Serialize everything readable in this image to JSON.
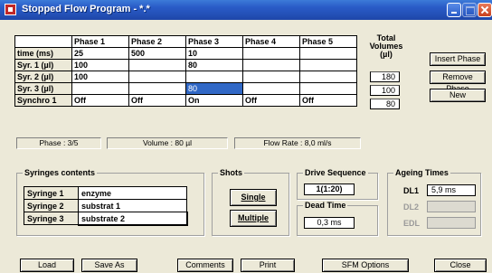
{
  "window": {
    "title": "Stopped Flow Program - *.*"
  },
  "grid": {
    "headers": [
      "",
      "Phase 1",
      "Phase 2",
      "Phase 3",
      "Phase 4",
      "Phase 5"
    ],
    "rows": [
      {
        "label": "time (ms)",
        "cells": [
          "25",
          "500",
          "10",
          "",
          ""
        ]
      },
      {
        "label": "Syr. 1 (µl)",
        "cells": [
          "100",
          "",
          "80",
          "",
          ""
        ]
      },
      {
        "label": "Syr. 2 (µl)",
        "cells": [
          "100",
          "",
          "",
          "",
          ""
        ]
      },
      {
        "label": "Syr. 3 (µl)",
        "cells": [
          "",
          "",
          "80",
          "",
          ""
        ]
      },
      {
        "label": "Synchro 1",
        "cells": [
          "Off",
          "Off",
          "On",
          "Off",
          "Off"
        ]
      }
    ]
  },
  "total_volumes": {
    "label_line1": "Total",
    "label_line2": "Volumes",
    "label_line3": "(µl)",
    "values": [
      "180",
      "100",
      "80"
    ]
  },
  "side_buttons": {
    "insert": "Insert Phase",
    "remove": "Remove Phase",
    "new": "New"
  },
  "status": {
    "phase": "Phase : 3/5",
    "volume": "Volume : 80 µl",
    "flow_rate": "Flow Rate : 8,0 ml/s"
  },
  "syringes": {
    "title": "Syringes contents",
    "items": [
      {
        "name": "Syringe  1",
        "value": "enzyme"
      },
      {
        "name": "Syringe  2",
        "value": "substrat 1"
      },
      {
        "name": "Syringe  3",
        "value": "substrate 2"
      }
    ]
  },
  "shots": {
    "title": "Shots",
    "single": "Single",
    "multiple": "Multiple"
  },
  "drive": {
    "title": "Drive Sequence",
    "value": "1(1:20)"
  },
  "dead_time": {
    "title": "Dead Time",
    "value": "0,3 ms"
  },
  "ageing": {
    "title": "Ageing Times",
    "dl1_label": "DL1",
    "dl1_value": "5,9 ms",
    "dl2_label": "DL2",
    "edl_label": "EDL"
  },
  "bottom_buttons": {
    "load": "Load",
    "save_as": "Save As",
    "comments": "Comments",
    "print": "Print",
    "sfm_options": "SFM Options",
    "close": "Close"
  },
  "colors": {
    "selection": "#3168c6",
    "window_bg": "#ece9d8",
    "titlebar": "#2a5cc8"
  }
}
